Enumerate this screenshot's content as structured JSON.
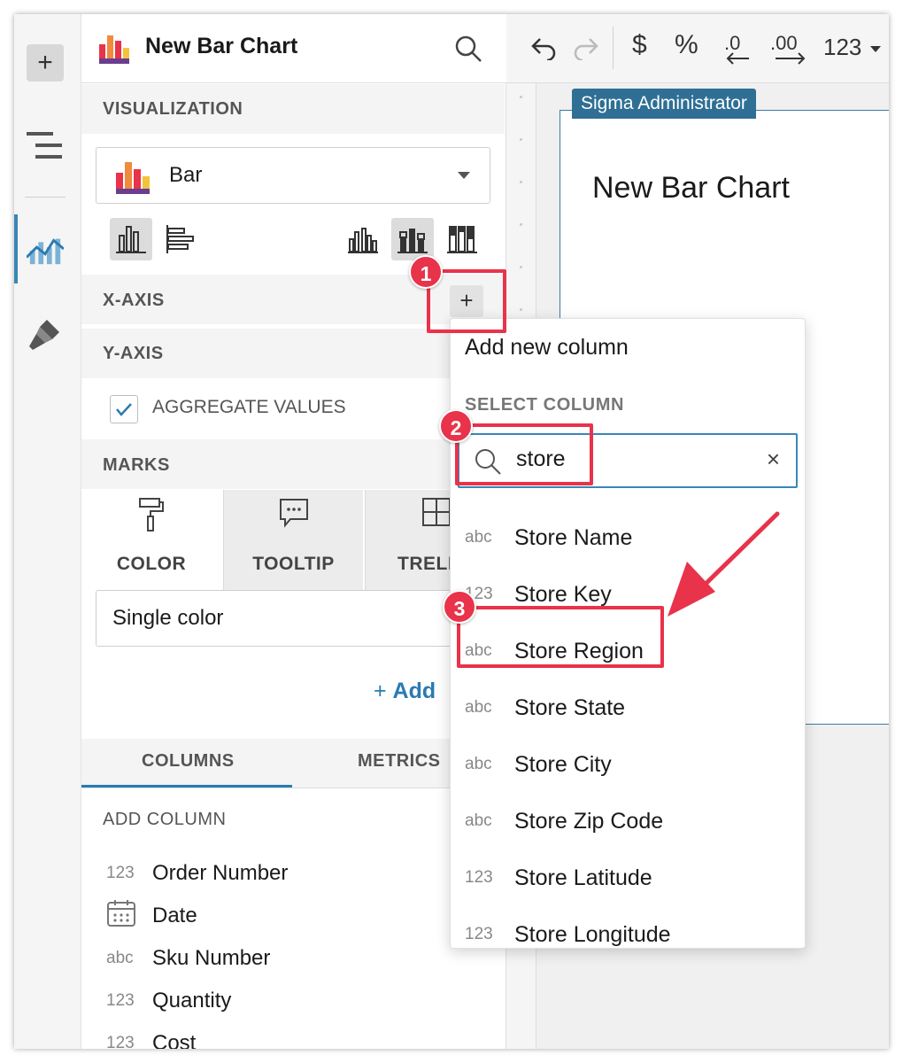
{
  "panel": {
    "title": "New Bar Chart",
    "sections": {
      "visualization": "VISUALIZATION",
      "x_axis": "X-AXIS",
      "y_axis": "Y-AXIS",
      "marks": "MARKS"
    },
    "chart_type_value": "Bar",
    "aggregate_label": "AGGREGATE VALUES",
    "aggregate_checked": true,
    "marks_tabs": [
      "COLOR",
      "TOOLTIP",
      "TRELI"
    ],
    "color_mode": "Single color",
    "add_label": "Add",
    "bottom_tabs": [
      "COLUMNS",
      "METRICS"
    ],
    "add_column_label": "ADD COLUMN",
    "columns": [
      {
        "type": "123",
        "name": "Order Number"
      },
      {
        "type": "date",
        "name": "Date"
      },
      {
        "type": "abc",
        "name": "Sku Number"
      },
      {
        "type": "123",
        "name": "Quantity"
      },
      {
        "type": "123",
        "name": "Cost"
      }
    ]
  },
  "toolbar": {
    "format_label": "123"
  },
  "canvas": {
    "user_badge": "Sigma Administrator",
    "card_title": "New Bar Chart"
  },
  "dropdown": {
    "add_new": "Add new column",
    "section": "SELECT COLUMN",
    "search_value": "store",
    "items": [
      {
        "type": "abc",
        "name": "Store Name"
      },
      {
        "type": "123",
        "name": "Store Key"
      },
      {
        "type": "abc",
        "name": "Store Region"
      },
      {
        "type": "abc",
        "name": "Store State"
      },
      {
        "type": "abc",
        "name": "Store City"
      },
      {
        "type": "abc",
        "name": "Store Zip Code"
      },
      {
        "type": "123",
        "name": "Store Latitude"
      },
      {
        "type": "123",
        "name": "Store Longitude"
      }
    ]
  },
  "annotations": [
    "1",
    "2",
    "3"
  ],
  "colors": {
    "accent": "#2a7bb0",
    "annotation": "#e8334a",
    "badge": "#2f6f95"
  }
}
